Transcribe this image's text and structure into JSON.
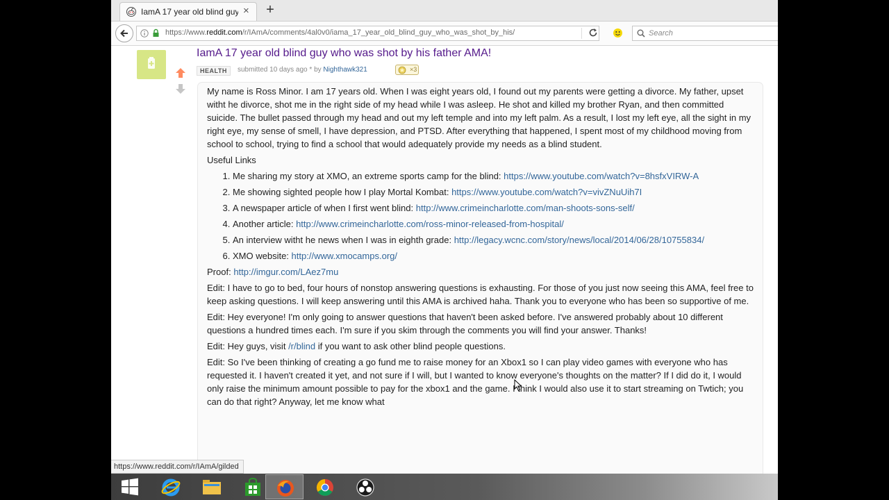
{
  "browser": {
    "tab_title": "IamA 17 year old blind guy who was shot by his father AMA!",
    "tab_close": "×",
    "newtab": "+",
    "url_prefix": "https://www.",
    "url_domain": "reddit.com",
    "url_path": "/r/IAmA/comments/4al0v0/iama_17_year_old_blind_guy_who_was_shot_by_his/",
    "search_placeholder": "Search",
    "status_url": "https://www.reddit.com/r/IAmA/gilded"
  },
  "post": {
    "title": "IamA 17 year old blind guy who was shot by his father AMA!",
    "flair": "HEALTH",
    "submitted_text": "submitted 10 days ago * by",
    "author": "Nighthawk321",
    "gilded_count": "×3",
    "intro": "My name is Ross Minor. I am 17 years old. When I was eight years old, I found out my parents were getting a divorce. My father, upset witht he divorce, shot me in the right side of my head while I was asleep. He shot and killed my brother Ryan, and then committed suicide. The bullet passed through my head and out my left temple and into my left palm. As a result, I lost my left eye, all the sight in my right eye, my sense of smell, I have depression, and PTSD. After everything that happened, I spent most of my childhood moving from school to school, trying to find a school that would adequately provide my needs as a blind student.",
    "useful_links_label": "Useful Links",
    "links": [
      {
        "text": "Me sharing my story at XMO, an extreme sports camp for the blind:",
        "url": "https://www.youtube.com/watch?v=8hsfxVIRW-A"
      },
      {
        "text": "Me showing sighted people how I play Mortal Kombat:",
        "url": "https://www.youtube.com/watch?v=vivZNuUih7I"
      },
      {
        "text": "A newspaper article of when I first went blind:",
        "url": "http://www.crimeincharlotte.com/man-shoots-sons-self/"
      },
      {
        "text": "Another article:",
        "url": "http://www.crimeincharlotte.com/ross-minor-released-from-hospital/"
      },
      {
        "text": "An interview witht he news when I was in eighth grade:",
        "url": "http://legacy.wcnc.com/story/news/local/2014/06/28/10755834/"
      },
      {
        "text": "XMO website:",
        "url": "http://www.xmocamps.org/"
      }
    ],
    "proof_label": "Proof:",
    "proof_url": "http://imgur.com/LAez7mu",
    "edit1": "Edit: I have to go to bed, four hours of nonstop answering questions is exhausting. For those of you just now seeing this AMA, feel free to keep asking questions. I will keep answering until this AMA is archived haha. Thank you to everyone who has been so supportive of me.",
    "edit2": "Edit: Hey everyone! I'm only going to answer questions that haven't been asked before. I've answered probably about 10 different questions a hundred times each. I'm sure if you skim through the comments you will find your answer. Thanks!",
    "edit3_before": "Edit: Hey guys, visit",
    "edit3_link": "/r/blind",
    "edit3_after": "if you want to ask other blind people questions.",
    "edit4": "Edit: So I've been thinking of creating a go fund me to raise money for an Xbox1 so I can play video games with everyone who has requested it. I haven't created it yet, and not sure if I will, but I wanted to know everyone's thoughts on the matter? If I did do it, I would only raise the minimum amount possible to pay for the xbox1 and the game. I think I would also use it to start streaming on Twtich; you can do that right? Anyway, let me know what"
  },
  "taskbar": {
    "items": [
      "windows-start",
      "internet-explorer",
      "file-explorer",
      "store",
      "firefox",
      "chrome",
      "obs"
    ]
  },
  "colors": {
    "link": "#336699",
    "visited_title": "#551a8b",
    "upvote": "#ff8b60",
    "thumb": "#d7e686"
  }
}
